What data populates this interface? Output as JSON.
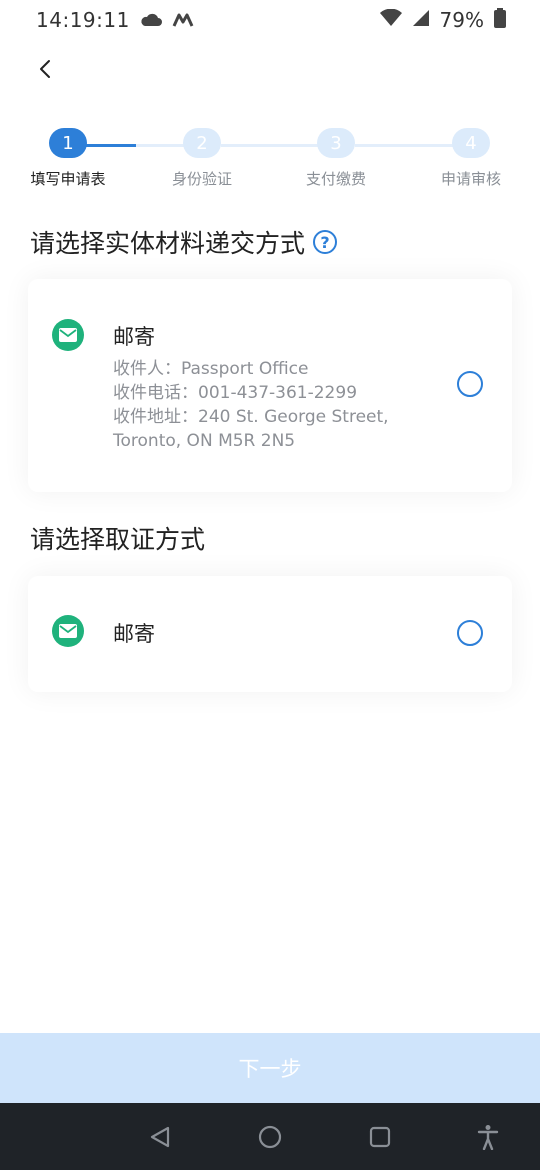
{
  "status_bar": {
    "time": "14:19:11",
    "battery": "79%",
    "icons": [
      "cloud-icon",
      "m-icon",
      "wifi-icon",
      "signal-icon",
      "battery-icon"
    ]
  },
  "nav": {
    "back_icon": "chevron-left-icon"
  },
  "stepper": {
    "steps": [
      {
        "number": "1",
        "label": "填写申请表",
        "active": true
      },
      {
        "number": "2",
        "label": "身份验证",
        "active": false
      },
      {
        "number": "3",
        "label": "支付缴费",
        "active": false
      },
      {
        "number": "4",
        "label": "申请审核",
        "active": false
      }
    ]
  },
  "submission": {
    "title": "请选择实体材料递交方式",
    "help_icon": "?",
    "option": {
      "title": "邮寄",
      "recipient": "收件人：Passport Office",
      "phone": "收件电话：001-437-361-2299",
      "address_line1": "收件地址：240 St. George Street,",
      "address_line2": "Toronto, ON M5R 2N5"
    }
  },
  "pickup": {
    "title": "请选择取证方式",
    "option": {
      "title": "邮寄"
    }
  },
  "next_button": {
    "label": "下一步"
  },
  "colors": {
    "accent": "#2d7fd8",
    "mail_green": "#1fb27c",
    "disabled_button": "#cfe4fb",
    "nav_bar": "#1f2328"
  }
}
